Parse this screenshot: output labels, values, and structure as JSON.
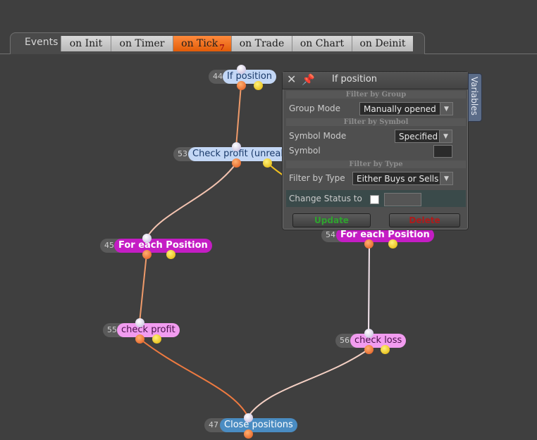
{
  "tabbar": {
    "title": "Events",
    "tabs": [
      {
        "label": "on Init"
      },
      {
        "label": "on Timer"
      },
      {
        "label": "on Tick",
        "badge": "7",
        "active": true
      },
      {
        "label": "on Trade"
      },
      {
        "label": "on Chart"
      },
      {
        "label": "on Deinit"
      }
    ]
  },
  "nodes": {
    "n44": {
      "num": "44",
      "label": "If position"
    },
    "n53": {
      "num": "53",
      "label": "Check profit (unrealiz"
    },
    "n45": {
      "num": "45",
      "label": "For each Position"
    },
    "n54": {
      "num": "54",
      "label": "For each Position"
    },
    "n55": {
      "num": "55",
      "label": "check profit"
    },
    "n56": {
      "num": "56",
      "label": "check loss"
    },
    "n47": {
      "num": "47",
      "label": "Close positions"
    }
  },
  "panel": {
    "title": "If position",
    "sections": {
      "group": "Filter by Group",
      "symbol": "Filter by Symbol",
      "type": "Filter by Type"
    },
    "group_mode_label": "Group Mode",
    "group_mode_value": "Manually opened",
    "symbol_mode_label": "Symbol Mode",
    "symbol_mode_value": "Specified",
    "symbol_label": "Symbol",
    "symbol_value": "",
    "type_label": "Filter by Type",
    "type_value": "Either Buys or Sells",
    "change_status_label": "Change Status to",
    "change_status_checked": false,
    "change_status_value": "",
    "update_label": "Update",
    "delete_label": "Delete"
  },
  "variables_tab": "Variables",
  "colors": {
    "accent_tab": "#e25c08",
    "update": "#2fa32f",
    "delete": "#b01a1a"
  }
}
